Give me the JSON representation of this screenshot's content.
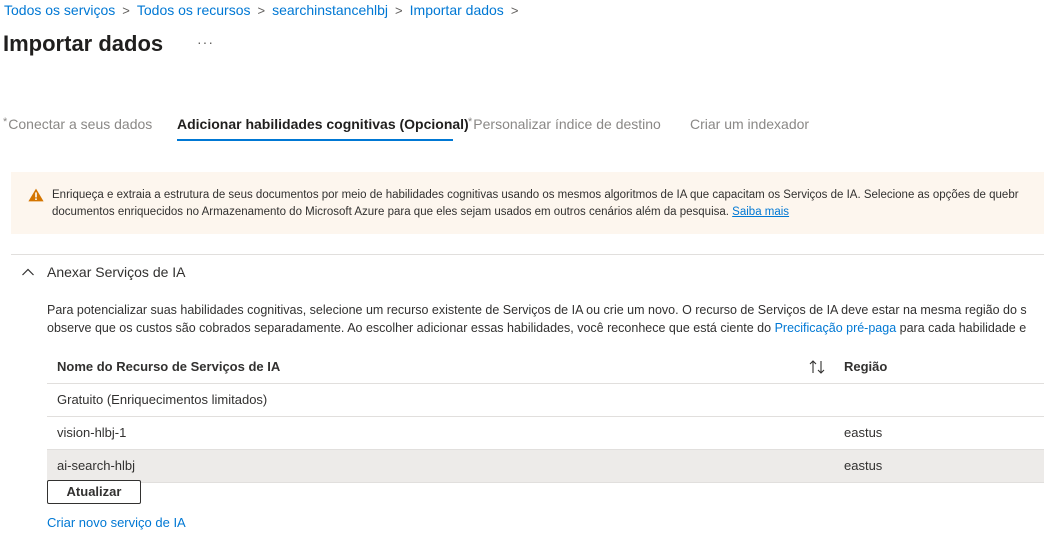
{
  "breadcrumb": {
    "items": [
      "Todos os serviços",
      "Todos os recursos",
      "searchinstancehlbj",
      "Importar dados"
    ],
    "separator": ">"
  },
  "header": {
    "title": "Importar dados",
    "more_label": "···"
  },
  "tabs": [
    {
      "label": "Conectar a seus dados",
      "required": true,
      "state": "inactive"
    },
    {
      "label": "Adicionar habilidades cognitivas (Opcional)",
      "required": false,
      "state": "active"
    },
    {
      "label": "Personalizar índice de destino",
      "required": true,
      "state": "inactive"
    },
    {
      "label": "Criar um indexador",
      "required": false,
      "state": "inactive"
    }
  ],
  "required_marker": "*",
  "banner": {
    "icon": "warning-icon",
    "line1": "Enriqueça e extraia a estrutura de seus documentos por meio de habilidades cognitivas usando os mesmos algoritmos de IA que capacitam os Serviços de IA. Selecione as opções de quebr",
    "line2": "documentos enriquecidos no Armazenamento do Microsoft Azure para que eles sejam usados em outros cenários além da pesquisa.",
    "link": "Saiba mais"
  },
  "section": {
    "title": "Anexar Serviços de IA",
    "expanded": true,
    "desc_line1": "Para potencializar suas habilidades cognitivas, selecione um recurso existente de Serviços de IA ou crie um novo. O recurso de Serviços de IA deve estar na mesma região do s",
    "desc_line2_pre": "observe que os custos são cobrados separadamente. Ao escolher adicionar essas habilidades, você reconhece que está ciente do",
    "desc_line2_link": "Precificação pré-paga",
    "desc_line2_post": "para cada habilidade e"
  },
  "table": {
    "columns": [
      "Nome do Recurso de Serviços de IA",
      "Região"
    ],
    "sort_icon": "sort-icon",
    "rows": [
      {
        "name": "Gratuito (Enriquecimentos limitados)",
        "region": "",
        "selected": false
      },
      {
        "name": "vision-hlbj-1",
        "region": "eastus",
        "selected": false
      },
      {
        "name": "ai-search-hlbj",
        "region": "eastus",
        "selected": true
      }
    ]
  },
  "actions": {
    "refresh_label": "Atualizar",
    "create_link": "Criar novo serviço de IA"
  },
  "colors": {
    "accent": "#0078d4",
    "warning": "#d47500",
    "banner_bg": "#fdf6ee",
    "selected_row": "#edebe9"
  }
}
